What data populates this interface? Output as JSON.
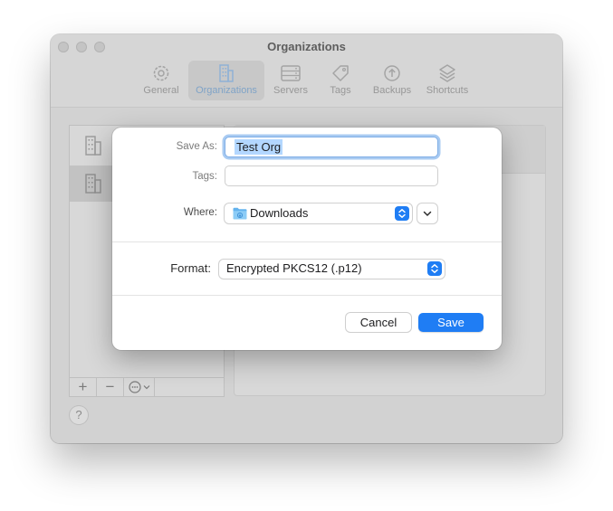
{
  "window": {
    "title": "Organizations"
  },
  "toolbar": {
    "items": [
      {
        "label": "General",
        "icon": "gear-icon"
      },
      {
        "label": "Organizations",
        "icon": "building-icon",
        "selected": true
      },
      {
        "label": "Servers",
        "icon": "server-icon"
      },
      {
        "label": "Tags",
        "icon": "tag-icon"
      },
      {
        "label": "Backups",
        "icon": "backup-arrow-icon"
      },
      {
        "label": "Shortcuts",
        "icon": "layers-icon"
      }
    ]
  },
  "sidebar": {
    "rows": [
      {
        "icon": "building-icon"
      },
      {
        "icon": "building-icon",
        "selected": true
      }
    ],
    "bottom_bar": {
      "add": "+",
      "remove": "−",
      "more_icon": "ellipsis-circle-icon"
    }
  },
  "help": {
    "label": "?"
  },
  "save_dialog": {
    "save_as_label": "Save As:",
    "save_as_value": "Test Org",
    "tags_label": "Tags:",
    "tags_value": "",
    "where_label": "Where:",
    "where_value": "Downloads",
    "where_icon": "folder-icon",
    "format_label": "Format:",
    "format_value": "Encrypted PKCS12 (.p12)",
    "cancel_label": "Cancel",
    "save_label": "Save"
  },
  "colors": {
    "accent": "#1f7df4",
    "selection": "#b3d7ff",
    "focus_ring": "#a9cbf2"
  }
}
